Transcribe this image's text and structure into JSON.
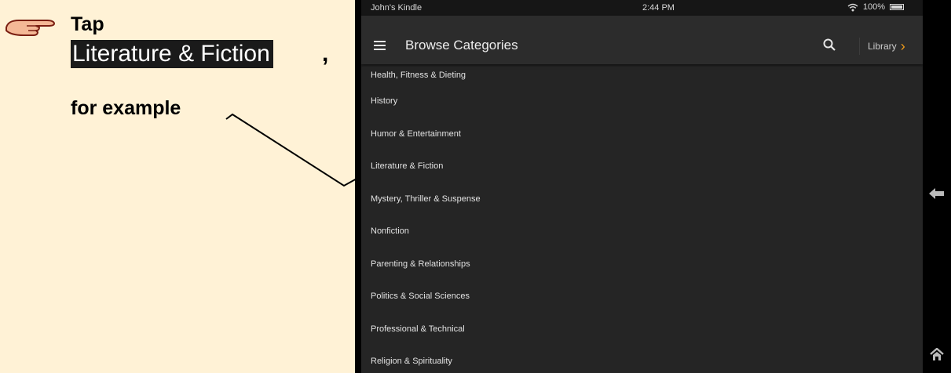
{
  "instruction": {
    "tap_label": "Tap",
    "highlighted_item": "Literature & Fiction",
    "comma": ",",
    "example_label": "for example",
    "icon": "pointing-hand-icon"
  },
  "status_bar": {
    "device_name": "John's Kindle",
    "time": "2:44 PM",
    "battery": "100%",
    "icons": [
      "wifi-icon",
      "battery-icon"
    ]
  },
  "app_bar": {
    "title": "Browse Categories",
    "library_label": "Library",
    "icons": [
      "menu-icon",
      "search-icon",
      "chevron-right-icon"
    ]
  },
  "categories": [
    "Health, Fitness & Dieting",
    "History",
    "Humor & Entertainment",
    "Literature & Fiction",
    "Mystery, Thriller & Suspense",
    "Nonfiction",
    "Parenting & Relationships",
    "Politics & Social Sciences",
    "Professional & Technical",
    "Religion & Spirituality"
  ],
  "nav": {
    "icons": [
      "back-arrow-icon",
      "home-icon"
    ]
  },
  "colors": {
    "instruction_bg": "#fff2d6",
    "screen_bg": "#252525",
    "accent": "#f29d1a"
  }
}
